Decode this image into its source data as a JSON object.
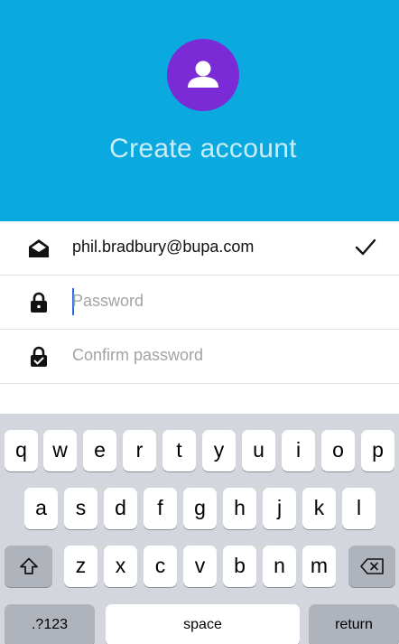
{
  "header": {
    "title": "Create account",
    "avatar_icon": "person-icon",
    "background_color": "#0aaae1",
    "avatar_color": "#7b2bd6"
  },
  "form": {
    "email": {
      "icon": "envelope-open-icon",
      "value": "phil.bradbury@bupa.com",
      "status_icon": "checkmark-icon"
    },
    "password": {
      "icon": "lock-icon",
      "placeholder": "Password",
      "focused": true
    },
    "confirm_password": {
      "icon": "lock-check-icon",
      "placeholder": "Confirm password"
    }
  },
  "keyboard": {
    "row1": [
      "q",
      "w",
      "e",
      "r",
      "t",
      "y",
      "u",
      "i",
      "o",
      "p"
    ],
    "row2": [
      "a",
      "s",
      "d",
      "f",
      "g",
      "h",
      "j",
      "k",
      "l"
    ],
    "row3": [
      "z",
      "x",
      "c",
      "v",
      "b",
      "n",
      "m"
    ],
    "shift_icon": "shift-icon",
    "delete_icon": "backspace-icon",
    "numbers_label": ".?123",
    "space_label": "space",
    "return_label": "return"
  }
}
